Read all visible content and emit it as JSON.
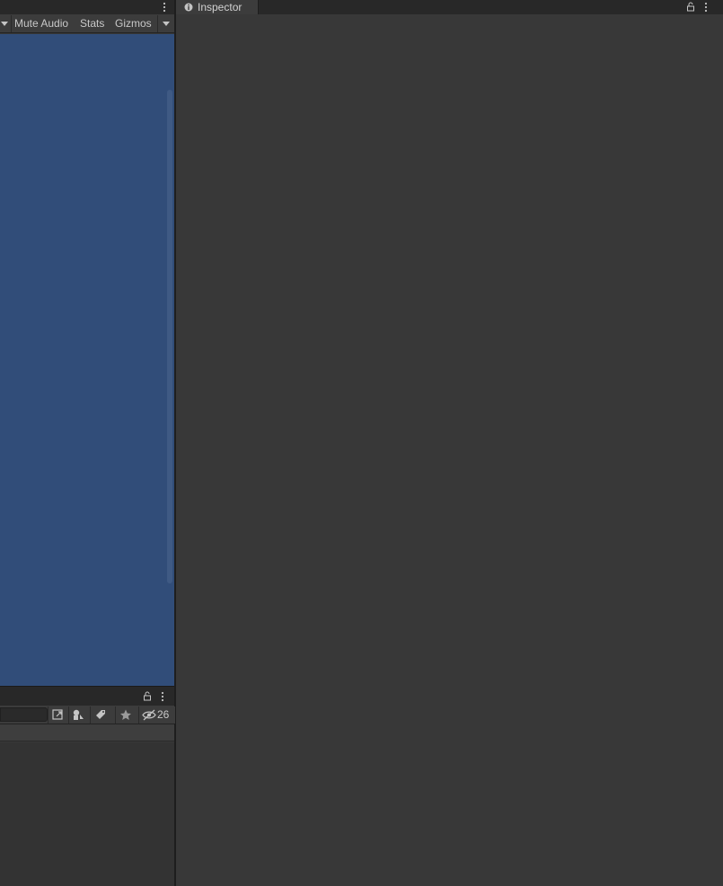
{
  "game_view": {
    "toolbar": {
      "mute_audio_label": "Mute Audio",
      "stats_label": "Stats",
      "gizmos_label": "Gizmos"
    },
    "background_color": "#314d79"
  },
  "hierarchy": {
    "hidden_count": "26"
  },
  "inspector": {
    "tab_label": "Inspector"
  },
  "icons": [
    "more-options-icon",
    "dropdown-caret-icon",
    "info-icon",
    "lock-icon",
    "scene-visibility-icon",
    "filter-by-type-icon",
    "filter-by-label-icon",
    "favorite-star-icon",
    "hidden-objects-eye-icon"
  ]
}
